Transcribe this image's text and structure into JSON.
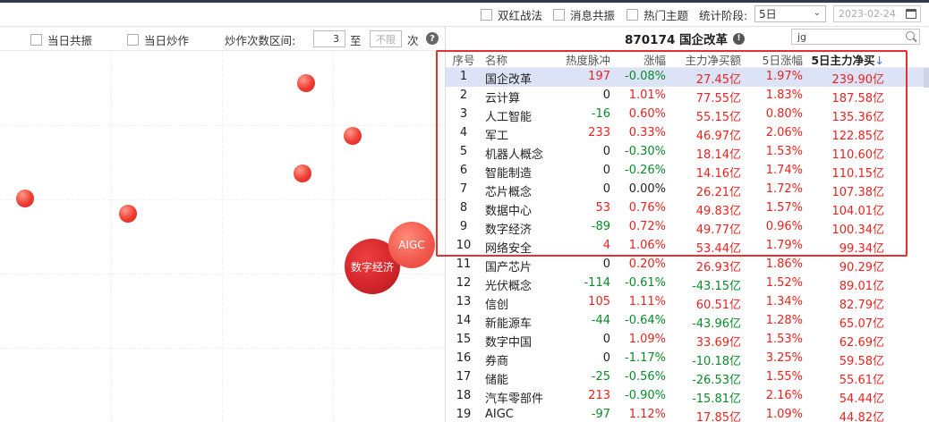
{
  "topbar": {
    "checkboxes": [
      "双红战法",
      "消息共振",
      "热门主题"
    ],
    "stage_label": "统计阶段:",
    "stage_value": "5日",
    "date_value": "2023-02-24"
  },
  "leftbar": {
    "same_day_resonance": "当日共振",
    "same_day_hype": "当日炒作",
    "range_label": "炒作次数区间:",
    "range_min": "3",
    "range_to": "至",
    "range_max_placeholder": "不限",
    "range_unit": "次"
  },
  "bubbles": {
    "big_label": "数字经济",
    "mid_label": "AIGC"
  },
  "panel": {
    "title": "870174 国企改革",
    "search_value": "jg"
  },
  "table": {
    "headers": {
      "idx": "序号",
      "name": "名称",
      "heat": "热度脉冲",
      "chg": "涨幅",
      "net": "主力净买额",
      "chg5": "5日涨幅",
      "net5": "5日主力净买",
      "sort_arrow": "↓"
    },
    "rows": [
      {
        "idx": "1",
        "name": "国企改革",
        "heat": "197",
        "chg": "-0.08%",
        "net": "27.45亿",
        "chg5": "1.97%",
        "net5": "239.90亿"
      },
      {
        "idx": "2",
        "name": "云计算",
        "heat": "0",
        "chg": "1.01%",
        "net": "77.55亿",
        "chg5": "1.83%",
        "net5": "187.58亿"
      },
      {
        "idx": "3",
        "name": "人工智能",
        "heat": "-16",
        "chg": "0.60%",
        "net": "55.15亿",
        "chg5": "0.80%",
        "net5": "135.36亿"
      },
      {
        "idx": "4",
        "name": "军工",
        "heat": "233",
        "chg": "0.33%",
        "net": "46.97亿",
        "chg5": "2.06%",
        "net5": "122.85亿"
      },
      {
        "idx": "5",
        "name": "机器人概念",
        "heat": "0",
        "chg": "-0.30%",
        "net": "18.14亿",
        "chg5": "1.53%",
        "net5": "110.60亿"
      },
      {
        "idx": "6",
        "name": "智能制造",
        "heat": "0",
        "chg": "-0.26%",
        "net": "14.16亿",
        "chg5": "1.74%",
        "net5": "110.15亿"
      },
      {
        "idx": "7",
        "name": "芯片概念",
        "heat": "0",
        "chg": "0.00%",
        "net": "26.21亿",
        "chg5": "1.72%",
        "net5": "107.38亿"
      },
      {
        "idx": "8",
        "name": "数据中心",
        "heat": "53",
        "chg": "0.76%",
        "net": "49.83亿",
        "chg5": "1.57%",
        "net5": "104.01亿"
      },
      {
        "idx": "9",
        "name": "数字经济",
        "heat": "-89",
        "chg": "0.72%",
        "net": "49.77亿",
        "chg5": "0.96%",
        "net5": "100.34亿"
      },
      {
        "idx": "10",
        "name": "网络安全",
        "heat": "4",
        "chg": "1.06%",
        "net": "53.44亿",
        "chg5": "1.79%",
        "net5": "99.34亿"
      },
      {
        "idx": "11",
        "name": "国产芯片",
        "heat": "0",
        "chg": "0.20%",
        "net": "26.93亿",
        "chg5": "1.86%",
        "net5": "90.29亿"
      },
      {
        "idx": "12",
        "name": "光伏概念",
        "heat": "-114",
        "chg": "-0.61%",
        "net": "-43.15亿",
        "chg5": "1.52%",
        "net5": "89.01亿"
      },
      {
        "idx": "13",
        "name": "信创",
        "heat": "105",
        "chg": "1.11%",
        "net": "60.51亿",
        "chg5": "1.34%",
        "net5": "82.79亿"
      },
      {
        "idx": "14",
        "name": "新能源车",
        "heat": "-44",
        "chg": "-0.64%",
        "net": "-43.96亿",
        "chg5": "1.28%",
        "net5": "65.07亿"
      },
      {
        "idx": "15",
        "name": "数字中国",
        "heat": "0",
        "chg": "1.09%",
        "net": "33.69亿",
        "chg5": "1.53%",
        "net5": "62.69亿"
      },
      {
        "idx": "16",
        "name": "券商",
        "heat": "0",
        "chg": "-1.17%",
        "net": "-10.18亿",
        "chg5": "3.25%",
        "net5": "59.58亿"
      },
      {
        "idx": "17",
        "name": "储能",
        "heat": "-25",
        "chg": "-0.56%",
        "net": "-26.53亿",
        "chg5": "1.55%",
        "net5": "55.61亿"
      },
      {
        "idx": "18",
        "name": "汽车零部件",
        "heat": "213",
        "chg": "-0.90%",
        "net": "-15.81亿",
        "chg5": "2.16%",
        "net5": "54.44亿"
      },
      {
        "idx": "19",
        "name": "AIGC",
        "heat": "-97",
        "chg": "1.12%",
        "net": "17.85亿",
        "chg5": "1.09%",
        "net5": "44.82亿"
      }
    ]
  },
  "colors": {
    "up": "#e8231f",
    "down": "#0a8a2a",
    "selected_row": "#dce3f7",
    "highlight_box": "#e53030"
  }
}
